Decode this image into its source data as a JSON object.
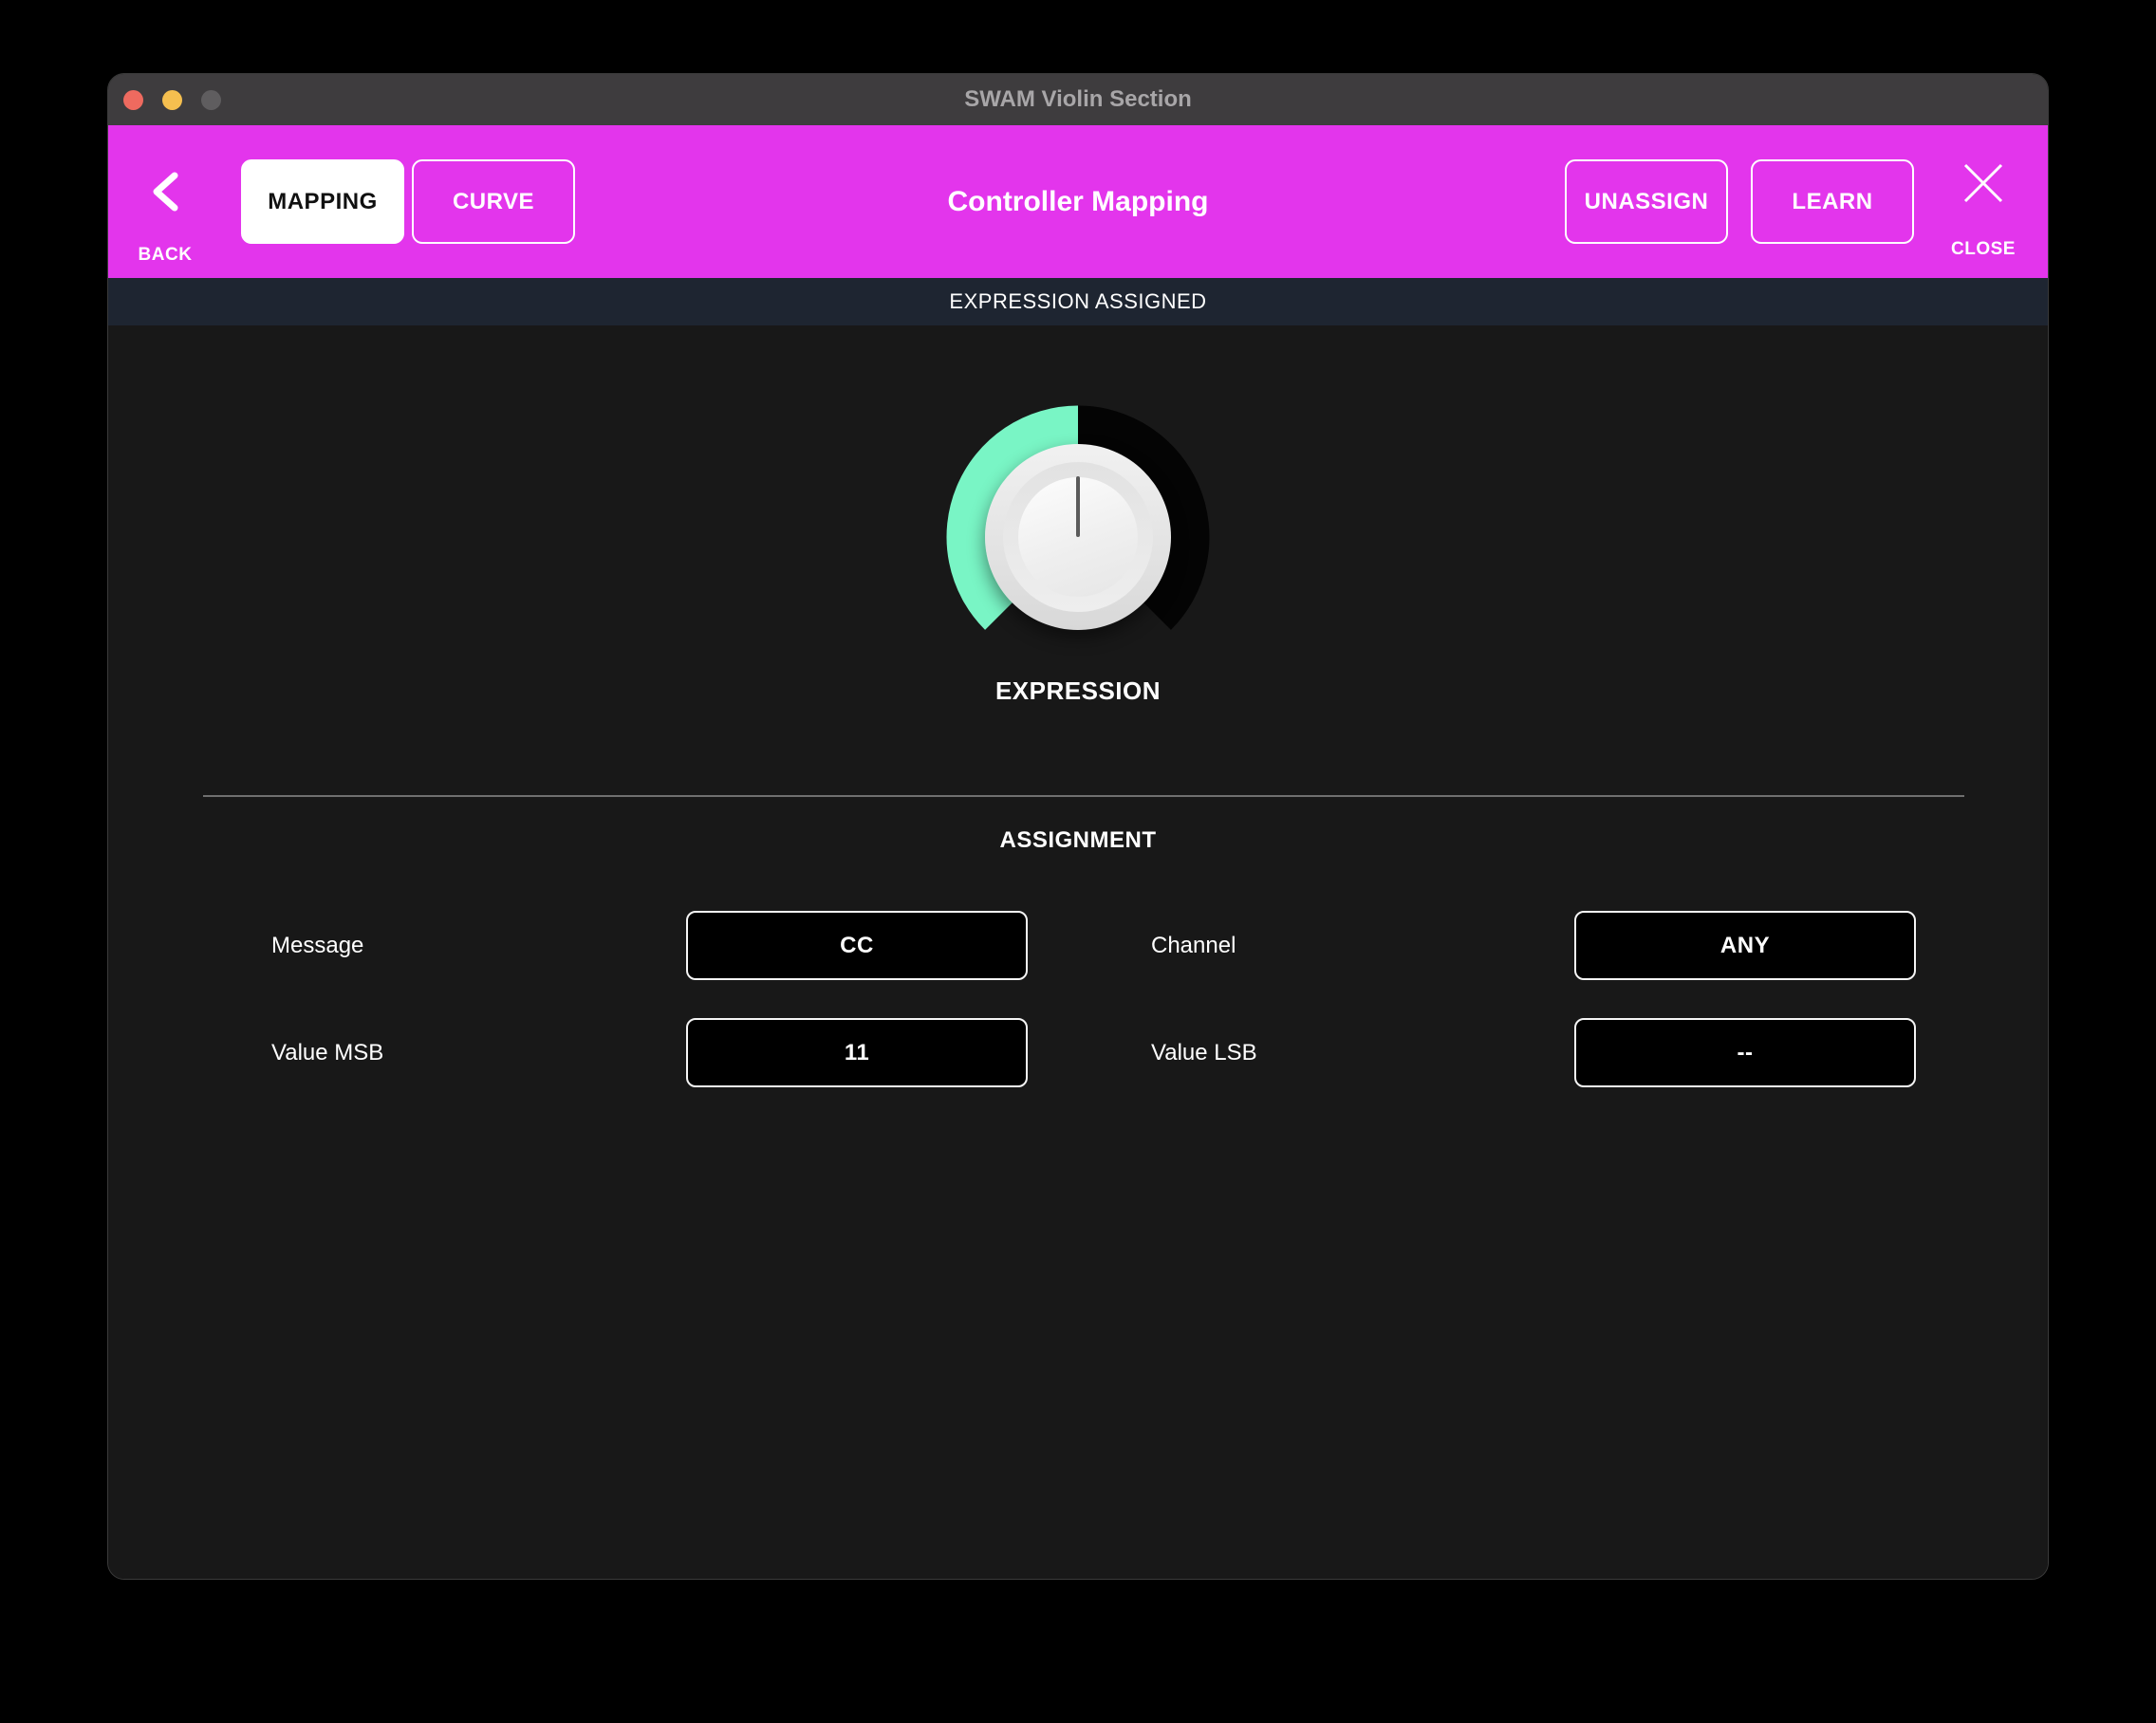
{
  "window": {
    "title": "SWAM Violin Section"
  },
  "header": {
    "back_label": "BACK",
    "tabs": [
      {
        "label": "MAPPING",
        "active": true
      },
      {
        "label": "CURVE",
        "active": false
      }
    ],
    "title": "Controller Mapping",
    "actions": [
      {
        "label": "UNASSIGN"
      },
      {
        "label": "LEARN"
      }
    ],
    "close_label": "CLOSE"
  },
  "status_bar": {
    "text": "EXPRESSION ASSIGNED"
  },
  "knob": {
    "label": "EXPRESSION",
    "value_percent": 50
  },
  "assignment": {
    "heading": "ASSIGNMENT",
    "fields": [
      {
        "label": "Message",
        "value": "CC"
      },
      {
        "label": "Channel",
        "value": "ANY"
      },
      {
        "label": "Value MSB",
        "value": "11"
      },
      {
        "label": "Value LSB",
        "value": "--"
      }
    ]
  },
  "colors": {
    "accent_magenta": "#e335ec",
    "status_bar_bg": "#1e2531",
    "knob_active": "#79f5c5",
    "knob_inactive": "#040404",
    "traffic_red": "#ee6a5f",
    "traffic_yellow": "#f5bf4f",
    "traffic_gray": "#5f5d5f"
  }
}
